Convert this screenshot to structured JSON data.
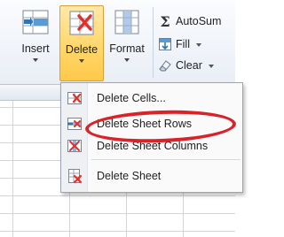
{
  "ribbon": {
    "insert": {
      "label": "Insert"
    },
    "delete": {
      "label": "Delete"
    },
    "format": {
      "label": "Format"
    },
    "editing": {
      "autosum": "AutoSum",
      "fill": "Fill",
      "clear": "Clear"
    }
  },
  "menu": {
    "items": [
      {
        "label": "Delete Cells...",
        "icon": "delete-cells-icon"
      },
      {
        "label": "Delete Sheet Rows",
        "icon": "delete-rows-icon"
      },
      {
        "label": "Delete Sheet Columns",
        "icon": "delete-columns-icon"
      },
      {
        "label": "Delete Sheet",
        "icon": "delete-sheet-icon"
      }
    ]
  },
  "colors": {
    "highlight_ring": "#d8232a",
    "active_button": "#ffd76b",
    "delete_red": "#e0322c"
  }
}
